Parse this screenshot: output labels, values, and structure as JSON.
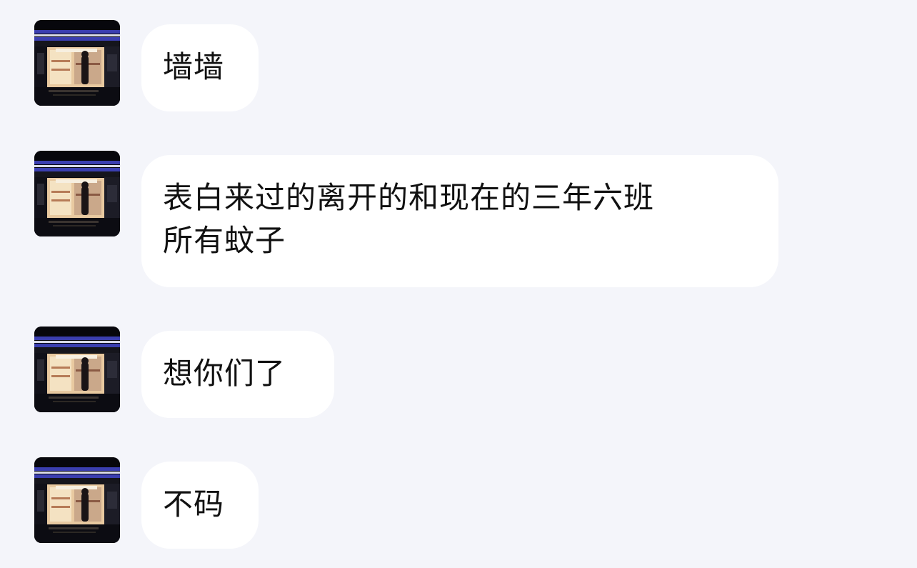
{
  "chat": {
    "messages": [
      {
        "sender_avatar": "convenience-store-night-avatar",
        "text": "墙墙"
      },
      {
        "sender_avatar": "convenience-store-night-avatar",
        "text": "表白来过的离开的和现在的三年六班\n所有蚊子"
      },
      {
        "sender_avatar": "convenience-store-night-avatar",
        "text": "想你们了"
      },
      {
        "sender_avatar": "convenience-store-night-avatar",
        "text": "不码"
      }
    ]
  },
  "colors": {
    "background": "#f4f5fa",
    "bubble": "#ffffff",
    "text": "#111111",
    "avatar_stripe": "#3b3fb0"
  }
}
